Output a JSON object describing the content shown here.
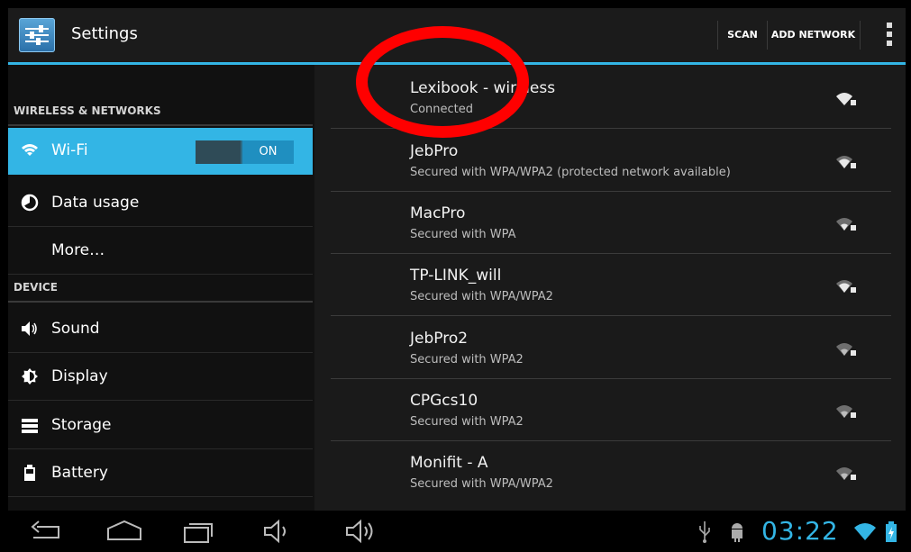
{
  "action_bar": {
    "title": "Settings",
    "scan_label": "SCAN",
    "add_network_label": "ADD NETWORK",
    "accent_color": "#33b5e5"
  },
  "left_pane": {
    "sections": {
      "wireless": "WIRELESS & NETWORKS",
      "device": "DEVICE"
    },
    "items": [
      {
        "label": "Wi-Fi",
        "icon": "wifi-icon",
        "selected": true,
        "toggle": "ON"
      },
      {
        "label": "Data usage",
        "icon": "data-usage-icon"
      },
      {
        "label": "More…",
        "icon": ""
      },
      {
        "label": "Sound",
        "icon": "speaker-icon"
      },
      {
        "label": "Display",
        "icon": "display-icon"
      },
      {
        "label": "Storage",
        "icon": "storage-icon"
      },
      {
        "label": "Battery",
        "icon": "battery-icon"
      }
    ]
  },
  "networks": [
    {
      "name": "Lexibook - wireless",
      "status": "Connected"
    },
    {
      "name": "JebPro",
      "status": "Secured with WPA/WPA2 (protected network available)"
    },
    {
      "name": "MacPro",
      "status": "Secured with WPA"
    },
    {
      "name": "TP-LINK_will",
      "status": "Secured with WPA/WPA2"
    },
    {
      "name": "JebPro2",
      "status": "Secured with WPA2"
    },
    {
      "name": "CPGcs10",
      "status": "Secured with WPA2"
    },
    {
      "name": "Monifit - A",
      "status": "Secured with WPA/WPA2"
    }
  ],
  "status_bar": {
    "time": "03:22"
  }
}
